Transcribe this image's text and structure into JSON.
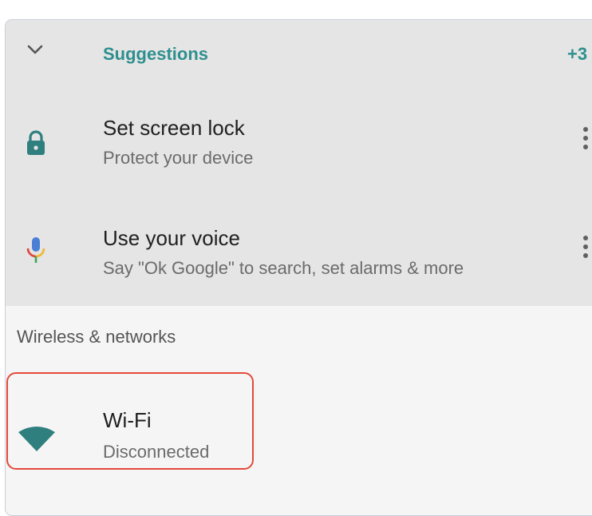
{
  "suggestions": {
    "title": "Suggestions",
    "count": "+3",
    "items": [
      {
        "title": "Set screen lock",
        "subtitle": "Protect your device",
        "icon": "lock-icon",
        "more_icon": "more-vert-icon"
      },
      {
        "title": "Use your voice",
        "subtitle": "Say \"Ok Google\" to search, set alarms & more",
        "icon": "microphone-icon",
        "more_icon": "more-vert-icon"
      }
    ]
  },
  "wireless": {
    "section_label": "Wireless & networks",
    "items": [
      {
        "title": "Wi-Fi",
        "subtitle": "Disconnected",
        "icon": "wifi-icon"
      }
    ]
  },
  "colors": {
    "accent": "#2f8f8f",
    "highlight_outline": "#e24a3b",
    "suggestions_bg": "#e5e5e5"
  }
}
